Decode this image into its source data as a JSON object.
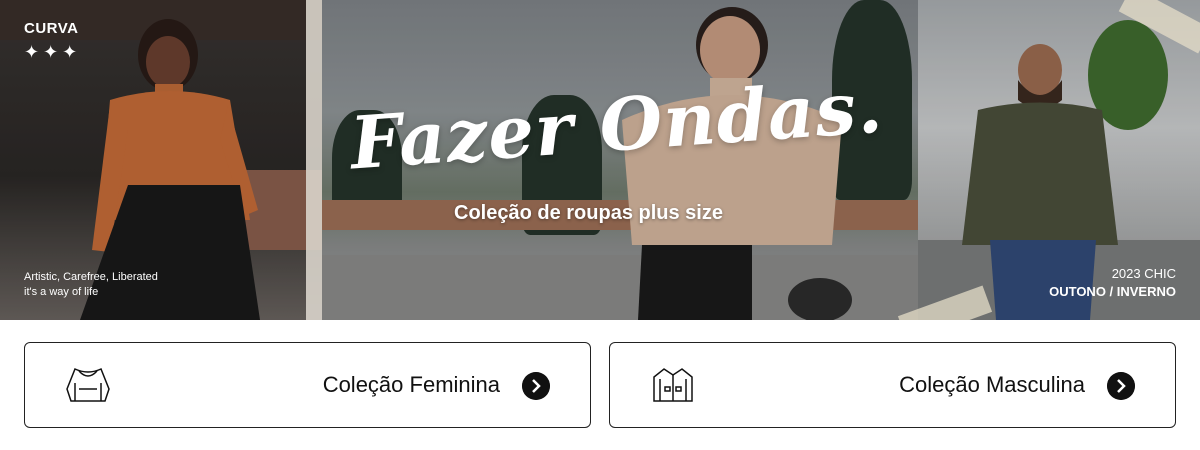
{
  "banner": {
    "brand": "CURVA",
    "stars": "✦✦✦",
    "tagline_line1": "Artistic, Carefree, Liberated",
    "tagline_line2": "it's a way of life",
    "headline": "Fazer Ondas.",
    "subtitle": "Coleção de roupas plus size",
    "season_line1": "2023 CHIC",
    "season_line2": "OUTONO / INVERNO"
  },
  "collections": [
    {
      "label": "Coleção Feminina",
      "icon": "blouse-icon"
    },
    {
      "label": "Coleção Masculina",
      "icon": "jacket-icon"
    }
  ],
  "colors": {
    "border": "#222222",
    "arrow_bg": "#111111",
    "text": "#111111"
  }
}
